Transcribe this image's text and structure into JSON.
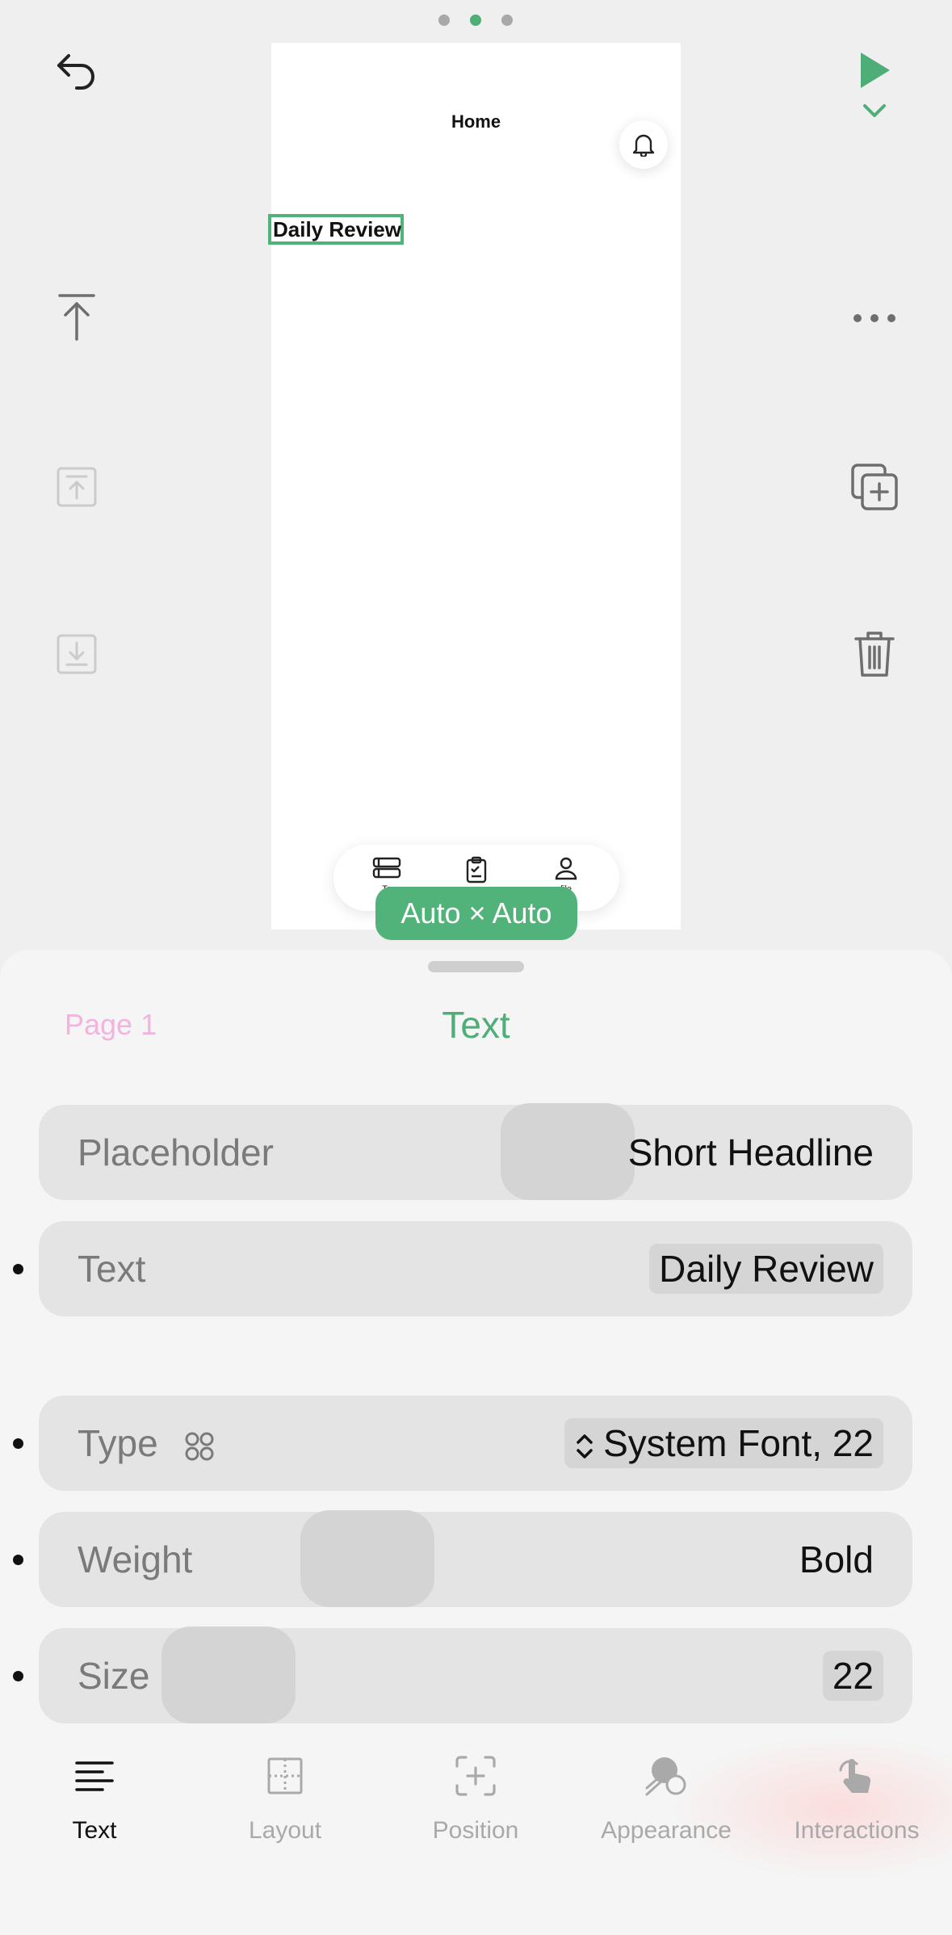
{
  "top": {
    "page_dots": [
      "dot-1",
      "dot-2-active",
      "dot-3"
    ],
    "undo_icon": "undo-icon",
    "run_icon": "play-icon",
    "run_menu_icon": "chevron-down-icon"
  },
  "canvas": {
    "nav_title": "Home",
    "bell_icon": "bell-icon",
    "selected_text": "Daily Review",
    "tabbar": {
      "items": [
        {
          "icon": "list-icon",
          "label": "To"
        },
        {
          "icon": "clipboard-icon",
          "label": ""
        },
        {
          "icon": "person-icon",
          "label": "file"
        }
      ]
    },
    "size_badge": "Auto × Auto"
  },
  "left_toolbar": [
    "move-to-top-icon",
    "bring-forward-icon",
    "send-backward-icon"
  ],
  "right_toolbar": [
    "more-icon",
    "duplicate-icon",
    "trash-icon"
  ],
  "sheet": {
    "page_label": "Page 1",
    "title": "Text",
    "rows": [
      {
        "label": "Placeholder",
        "value": "Short Headline"
      },
      {
        "label": "Text",
        "value": "Daily Review"
      },
      {
        "label": "Type",
        "value": "System Font, 22"
      },
      {
        "label": "Weight",
        "value": "Bold"
      },
      {
        "label": "Size",
        "value": "22"
      }
    ]
  },
  "tabs": [
    {
      "label": "Text",
      "icon": "text-align-icon",
      "active": true
    },
    {
      "label": "Layout",
      "icon": "layout-icon",
      "active": false
    },
    {
      "label": "Position",
      "icon": "position-icon",
      "active": false
    },
    {
      "label": "Appearance",
      "icon": "appearance-icon",
      "active": false
    },
    {
      "label": "Interactions",
      "icon": "tap-icon",
      "active": false
    }
  ],
  "colors": {
    "accent": "#4fae78",
    "selection": "#52b37a",
    "background": "#efefef"
  }
}
